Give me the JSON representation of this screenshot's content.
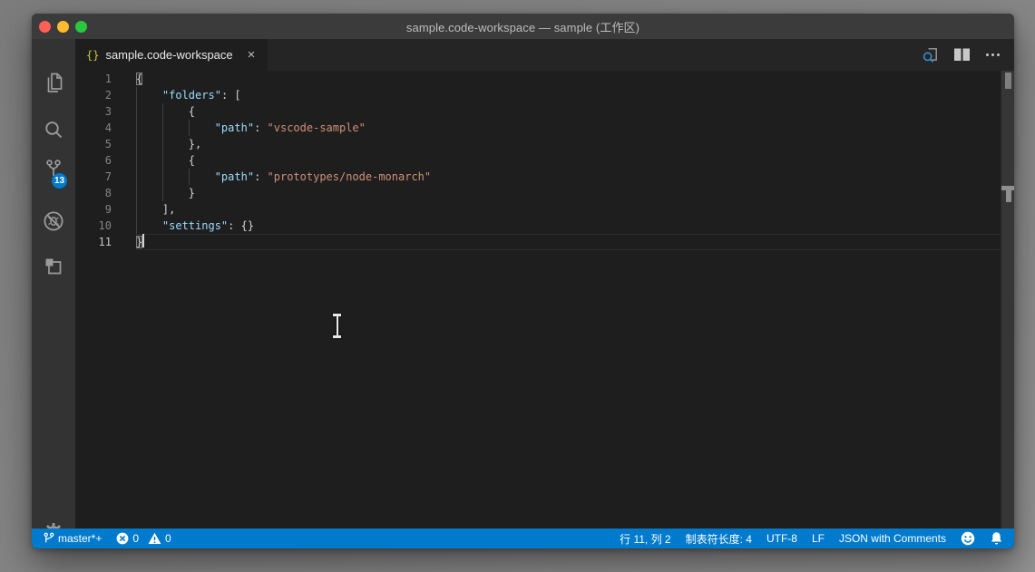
{
  "window": {
    "title": "sample.code-workspace — sample (工作区)"
  },
  "activity_bar": {
    "items": [
      {
        "id": "explorer",
        "icon": "files-icon"
      },
      {
        "id": "search",
        "icon": "search-icon"
      },
      {
        "id": "source-control",
        "icon": "source-control-icon",
        "badge": "13"
      },
      {
        "id": "debug",
        "icon": "debug-icon"
      },
      {
        "id": "extensions",
        "icon": "extensions-icon"
      }
    ],
    "bottom": {
      "id": "manage",
      "icon": "gear-icon"
    },
    "badge_color": "#007acc"
  },
  "tab_bar": {
    "tabs": [
      {
        "label": "sample.code-workspace",
        "icon_text": "{}",
        "close": "×",
        "active": true
      }
    ],
    "actions": [
      {
        "id": "open-preview",
        "icon": "preview-search-icon"
      },
      {
        "id": "split-editor",
        "icon": "split-editor-icon"
      },
      {
        "id": "more-actions",
        "icon": "ellipsis-icon"
      }
    ]
  },
  "editor": {
    "language": "jsonc",
    "colors": {
      "key": "#9cdcfe",
      "string": "#ce9178",
      "punctuation": "#d4d4d4",
      "background": "#1e1e1e"
    },
    "cursor_line": 11,
    "lines": [
      {
        "n": 1,
        "tokens": [
          {
            "t": "{",
            "s": "p",
            "match": true
          }
        ]
      },
      {
        "n": 2,
        "tokens": [
          {
            "t": "    ",
            "s": "p"
          },
          {
            "t": "\"folders\"",
            "s": "key"
          },
          {
            "t": ": [",
            "s": "p"
          }
        ]
      },
      {
        "n": 3,
        "tokens": [
          {
            "t": "        {",
            "s": "p"
          }
        ]
      },
      {
        "n": 4,
        "tokens": [
          {
            "t": "            ",
            "s": "p"
          },
          {
            "t": "\"path\"",
            "s": "key"
          },
          {
            "t": ": ",
            "s": "p"
          },
          {
            "t": "\"vscode-sample\"",
            "s": "str"
          }
        ]
      },
      {
        "n": 5,
        "tokens": [
          {
            "t": "        },",
            "s": "p"
          }
        ]
      },
      {
        "n": 6,
        "tokens": [
          {
            "t": "        {",
            "s": "p"
          }
        ]
      },
      {
        "n": 7,
        "tokens": [
          {
            "t": "            ",
            "s": "p"
          },
          {
            "t": "\"path\"",
            "s": "key"
          },
          {
            "t": ": ",
            "s": "p"
          },
          {
            "t": "\"prototypes/node-monarch\"",
            "s": "str"
          }
        ]
      },
      {
        "n": 8,
        "tokens": [
          {
            "t": "        }",
            "s": "p"
          }
        ]
      },
      {
        "n": 9,
        "tokens": [
          {
            "t": "    ],",
            "s": "p"
          }
        ]
      },
      {
        "n": 10,
        "tokens": [
          {
            "t": "    ",
            "s": "p"
          },
          {
            "t": "\"settings\"",
            "s": "key"
          },
          {
            "t": ": {}",
            "s": "p"
          }
        ]
      },
      {
        "n": 11,
        "tokens": [
          {
            "t": "}",
            "s": "p",
            "match": true
          }
        ],
        "cursor": true,
        "current": true
      }
    ]
  },
  "status_bar": {
    "background": "#007acc",
    "left": {
      "branch": "master*+",
      "errors": "0",
      "warnings": "0"
    },
    "right": {
      "cursor_position": "行 11, 列 2",
      "indent": "制表符长度: 4",
      "encoding": "UTF-8",
      "eol": "LF",
      "language_mode": "JSON with Comments"
    }
  }
}
